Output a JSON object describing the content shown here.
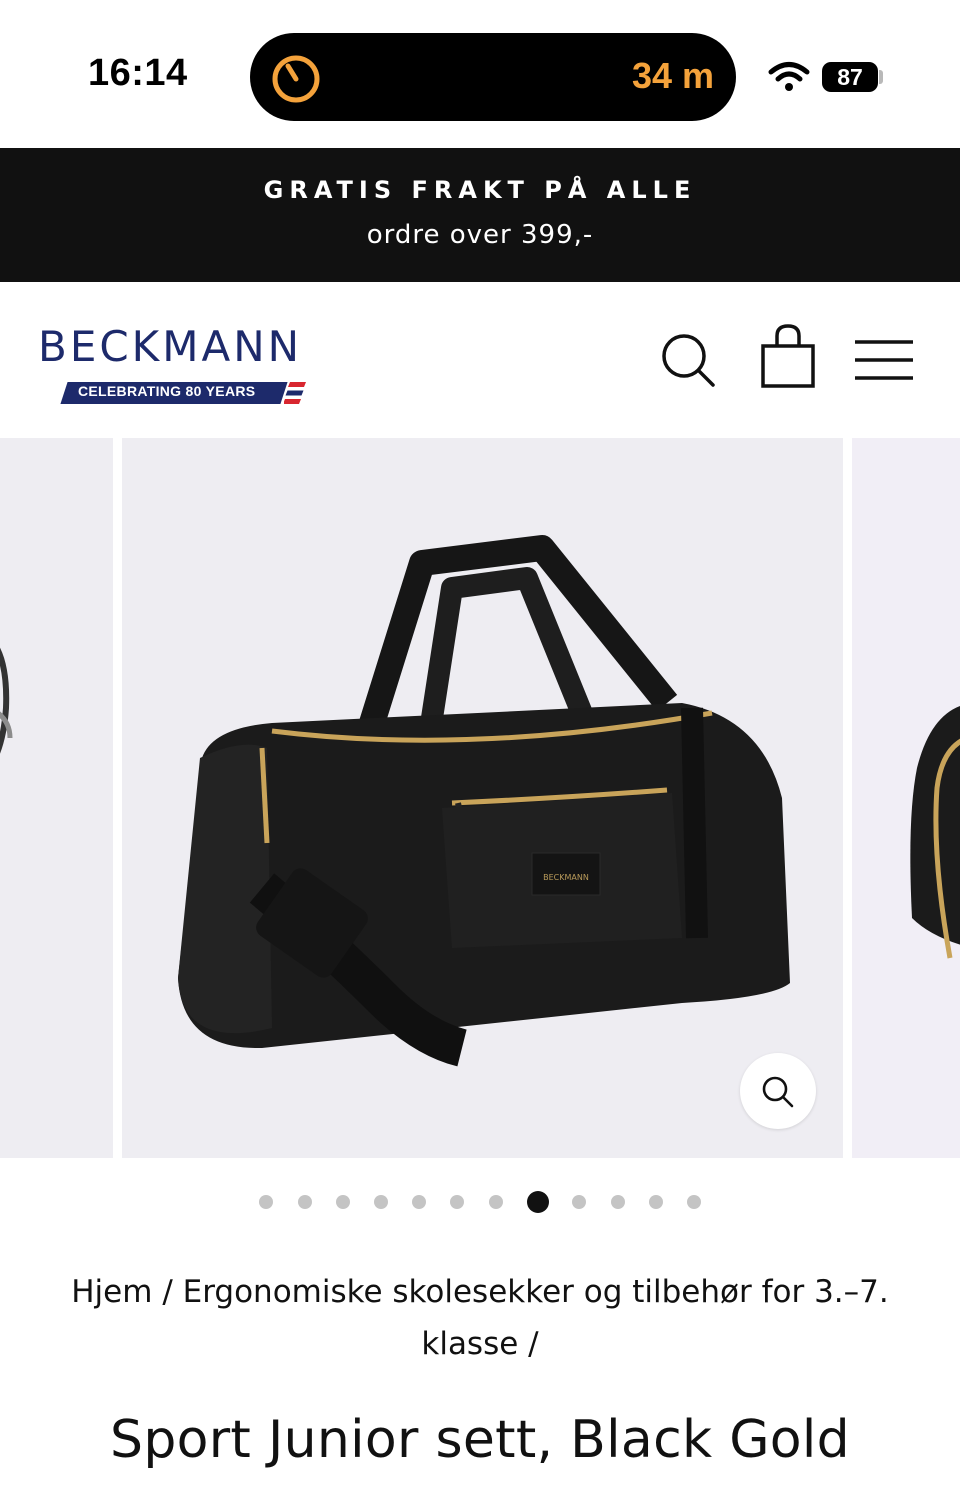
{
  "status_bar": {
    "time": "16:14",
    "timer_label": "34 m",
    "battery_level": "87",
    "accent_color": "#f4a23b"
  },
  "promo": {
    "line1": "GRATIS FRAKT PÅ ALLE",
    "line2": "ordre over 399,-"
  },
  "header": {
    "logo_text": "BECKMANN",
    "logo_tagline": "CELEBRATING 80 YEARS",
    "brand_color": "#1d2a6b",
    "icons": [
      "search-icon",
      "shopping-bag-icon",
      "menu-icon"
    ]
  },
  "gallery": {
    "slide_count": 12,
    "active_index": 8
  },
  "breadcrumb": {
    "home": "Hjem",
    "category": "Ergonomiske skolesekker og tilbehør for 3.–7. klasse",
    "separator": "/"
  },
  "product": {
    "title": "Sport Junior sett, Black Gold"
  }
}
